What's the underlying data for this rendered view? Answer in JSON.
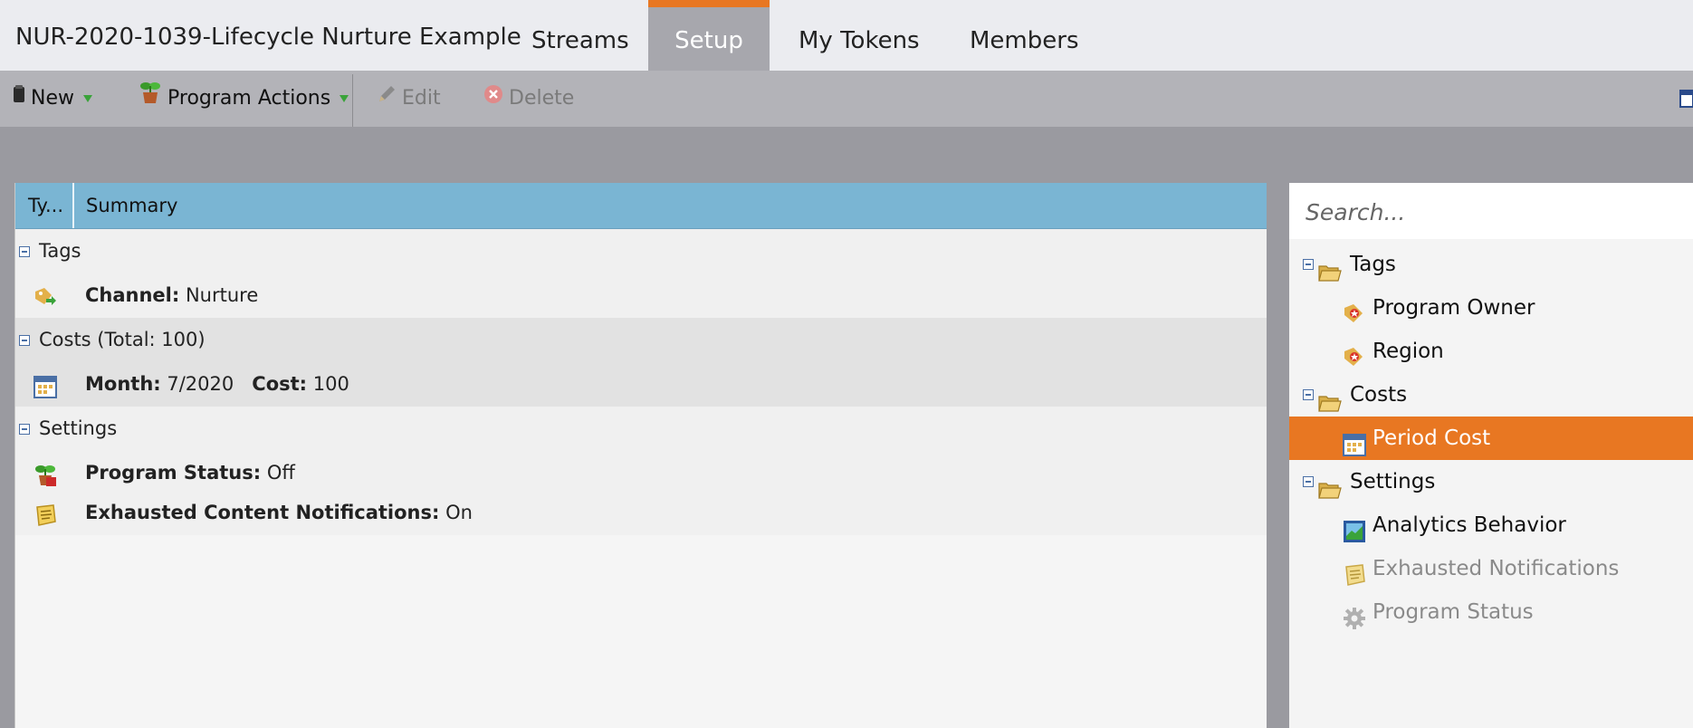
{
  "program_title": "NUR-2020-1039-Lifecycle Nurture Example",
  "tabs": [
    {
      "label": "Streams"
    },
    {
      "label": "Setup",
      "active": true
    },
    {
      "label": "My Tokens"
    },
    {
      "label": "Members"
    }
  ],
  "toolbar": {
    "new_label": "New",
    "program_actions_label": "Program Actions",
    "edit_label": "Edit",
    "delete_label": "Delete"
  },
  "grid": {
    "col_type": "Ty...",
    "col_summary": "Summary",
    "groups": [
      {
        "label": "Tags",
        "rows": [
          {
            "key": "Channel:",
            "value": "Nurture"
          }
        ]
      },
      {
        "label": "Costs (Total: 100)",
        "rows": [
          {
            "key": "Month:",
            "value": "7/2020",
            "key2": "Cost:",
            "value2": "100"
          }
        ]
      },
      {
        "label": "Settings",
        "rows": [
          {
            "key": "Program Status:",
            "value": "Off"
          },
          {
            "key": "Exhausted Content Notifications:",
            "value": "On"
          }
        ]
      }
    ]
  },
  "tree": {
    "search_placeholder": "Search...",
    "folders": [
      {
        "label": "Tags",
        "items": [
          "Program Owner",
          "Region"
        ]
      },
      {
        "label": "Costs",
        "items": [
          "Period Cost"
        ]
      },
      {
        "label": "Settings",
        "items": [
          "Analytics Behavior",
          "Exhausted Notifications",
          "Program Status"
        ]
      }
    ],
    "selected_item": "Period Cost"
  },
  "colors": {
    "accent": "#e87722",
    "grid_header": "#7ab5d3",
    "toolbar": "#b3b3b8"
  }
}
